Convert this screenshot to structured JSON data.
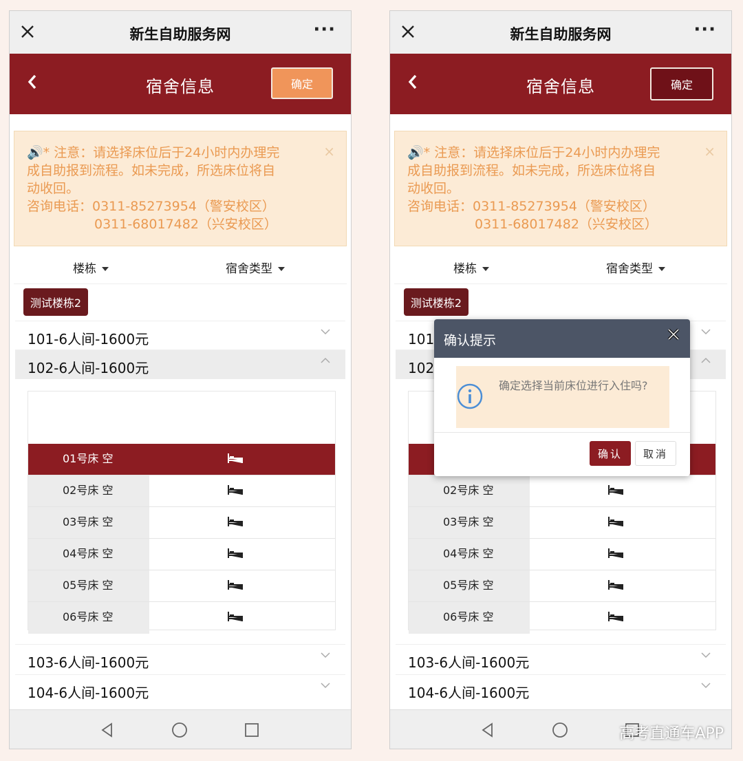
{
  "wechat": {
    "title": "新生自助服务网",
    "more": "···"
  },
  "header": {
    "title": "宿舍信息",
    "confirm": "确定"
  },
  "notice": {
    "lines": [
      "* 注意：请选择床位后于24小时内办理完",
      "成自助报到流程。如未完成，所选床位将自",
      "动收回。",
      "咨询电话：0311-85273954（警安校区）",
      "0311-68017482（兴安校区）"
    ]
  },
  "filters": {
    "building": "楼栋",
    "type": "宿舍类型"
  },
  "building_tag": "测试楼栋2",
  "rooms": [
    {
      "label": "101-6人间-1600元"
    },
    {
      "label": "102-6人间-1600元"
    },
    {
      "label": "103-6人间-1600元"
    },
    {
      "label": "104-6人间-1600元"
    }
  ],
  "beds": [
    "01号床 空",
    "02号床 空",
    "03号床 空",
    "04号床 空",
    "05号床 空",
    "06号床 空"
  ],
  "dialog": {
    "title": "确认提示",
    "message": "确定选择当前床位进行入住吗?",
    "ok": "确认",
    "cancel": "取消"
  },
  "watermark": "高考直通车APP",
  "colors": {
    "primary": "#8c1c22",
    "accent": "#f0955a",
    "notice_bg": "#fcebd6",
    "notice_text": "#ea9a52"
  }
}
